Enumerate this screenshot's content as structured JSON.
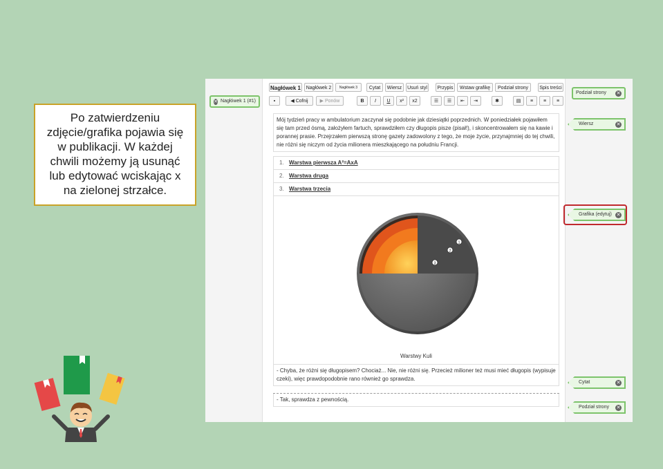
{
  "callout": {
    "lines": [
      "Po zatwierdzeniu",
      "zdjęcie/grafika pojawia się",
      "w publikacji. W każdej",
      "chwili możemy ją usunąć",
      "lub edytować wciskając x",
      "na zielonej strzałce."
    ]
  },
  "left_tag": {
    "label": "Nagłówek 1 (#1)"
  },
  "toolbar": {
    "row1": [
      "Nagłówek 1",
      "Nagłówek 2",
      "Nagłówek 3",
      "Cytat",
      "Wiersz",
      "Usuń styl",
      "Przypis",
      "Wstaw grafikę",
      "Podział strony",
      "Spis treści"
    ],
    "undo": "Cofnij",
    "redo": "Ponów",
    "format": [
      "B",
      "I",
      "U",
      "x²",
      "x2"
    ]
  },
  "right_tags": {
    "podzial1": "Podział strony",
    "wiersz": "Wiersz",
    "grafika": "Grafika (edytuj)",
    "cytat": "Cytat",
    "podzial2": "Podział strony"
  },
  "editor": {
    "paragraph1": "Mój tydzień pracy w ambulatorium zaczynał się podobnie jak dziesiątki poprzednich. W poniedziałek pojawiłem się tam przed ósmą, założyłem fartuch, sprawdziłem czy długopis pisze (pisał!), i skoncentrowałem się na kawie i porannej prasie. Przejrzałem pierwszą stronę gazety zadowolony z tego, że moje życie, przynajmniej do tej chwili, nie różni się niczym od życia milionera mieszkającego na południu Francji.",
    "list": [
      {
        "n": "1.",
        "text": "Warstwa pierwsza A²=AxA"
      },
      {
        "n": "2.",
        "text": "Warstwa druga"
      },
      {
        "n": "3.",
        "text": "Warstwa trzecia"
      }
    ],
    "figure_caption": "Warstwy Kuli",
    "figure_labels": [
      "1",
      "2",
      "3"
    ],
    "quote": "- Chyba, że różni się długopisem? Chociaż... Nie, nie różni się. Przecież milioner też musi mieć długopis (wypisuje czeki), więc prawdopodobnie rano również go sprawdza.",
    "last_line": "- Tak, sprawdza z pewnością."
  }
}
